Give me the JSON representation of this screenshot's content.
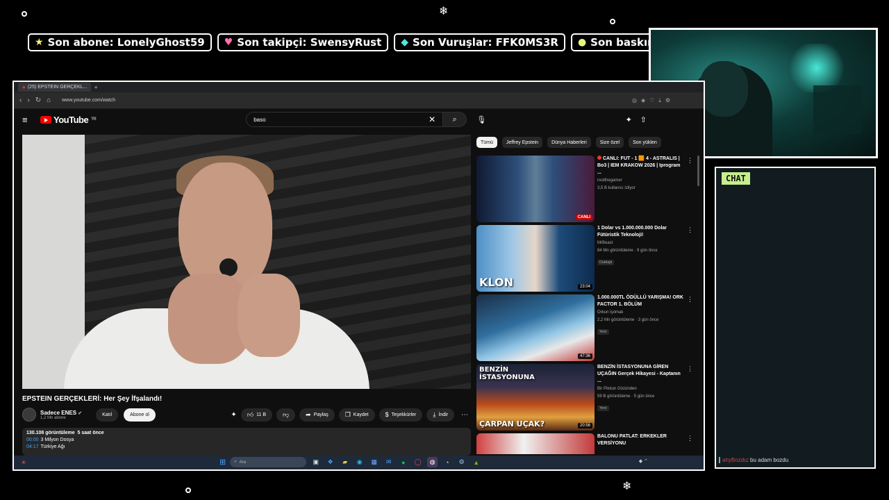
{
  "overlay": {
    "alerts": [
      {
        "icon": "star-icon",
        "glyph": "★",
        "text": "Son abone: LonelyGhost59",
        "color": "#fff27a"
      },
      {
        "icon": "heart-icon",
        "glyph": "♥",
        "text": "Son takipçi: SwensyRust",
        "color": "#ff6fae"
      },
      {
        "icon": "gem-icon",
        "glyph": "◆",
        "text": "Son Vuruşlar: FFK0MS3R",
        "color": "#4ee7e0"
      },
      {
        "icon": "coin-icon",
        "glyph": "●",
        "text": "Son baskın: tomrishim",
        "color": "#e9f57a"
      }
    ],
    "chat": {
      "tag": "CHAT",
      "message_user": "ahyBozdu",
      "message_text": ": bu adam bozdu"
    }
  },
  "browser": {
    "tab_title": "(25) EPSTEIN GERÇEKL...",
    "new_tab": "+",
    "url": "www.youtube.com/watch"
  },
  "youtube": {
    "logo": "YouTube",
    "country": "TR",
    "search_value": "baso",
    "video": {
      "title": "EPSTEIN GERÇEKLERİ: Her Şey İfşalandı!",
      "channel": "Sadece ENES",
      "subscribers": "1,2 Mn abone",
      "join_label": "Katıl",
      "subscribe_label": "Abone ol",
      "likes": "11 B",
      "share_label": "Paylaş",
      "save_label": "Kaydet",
      "thanks_label": "Teşekkürler",
      "download_label": "İndir",
      "views": "130.108 görüntüleme",
      "age": "5 saat önce",
      "chapters": [
        {
          "time": "00:00",
          "title": "3 Milyon Dosya"
        },
        {
          "time": "04:17",
          "title": "Türkiye Ağı"
        }
      ]
    },
    "chips": [
      "Tümü",
      "Jeffrey Epstein",
      "Dünya Haberleri",
      "Size özel",
      "Son yüklen"
    ],
    "recommendations": [
      {
        "title": "CANLI: FUT - 1 🟧 4 - ASTRALIS | Bo3 | IEM KRAKOW 2026 | Iprogram ...",
        "channel": "rootthegamer",
        "meta": "3,5 B kullanıcı izliyor",
        "badge": "",
        "duration": "",
        "live_label": "CANLI",
        "is_live": true,
        "overlay_text": "",
        "thumb_bg": "#1b2745"
      },
      {
        "title": "1 Dolar vs 1.000.000.000 Dolar Fütüristik Teknoloji!",
        "channel": "MrBeast",
        "meta": "84 Mn görüntüleme · 9 gün önce",
        "badge": "Dublajlı",
        "duration": "23:04",
        "live_label": "",
        "is_live": false,
        "overlay_text": "KLON",
        "thumb_bg": "#2e6fae"
      },
      {
        "title": "1.000.000TL ÖDÜLLÜ YARIŞMA! ORK FACTOR 1. BÖLÜM",
        "channel": "Orkun Işıtmak",
        "meta": "2,2 Mn görüntüleme · 3 gün önce",
        "badge": "Yeni",
        "duration": "47:36",
        "live_label": "",
        "is_live": false,
        "overlay_text": "",
        "thumb_bg": "#1f5f8f"
      },
      {
        "title": "BENZİN İSTASYONUNA GİREN UÇAĞIN Gerçek Hikayesi - Kaptanın ...",
        "channel": "Bir Pilotun Gözünden",
        "meta": "59 B görüntüleme · 5 gün önce",
        "badge": "Yeni",
        "duration": "20:56",
        "live_label": "",
        "is_live": false,
        "overlay_text": "BENZİN İSTASYONUNA",
        "overlay_text2": "ÇARPAN UÇAK?",
        "thumb_bg": "#9a4a1c"
      },
      {
        "title": "BALONU PATLAT: ERKEKLER VERSİYONU",
        "channel": "",
        "meta": "",
        "badge": "",
        "duration": "",
        "live_label": "",
        "is_live": false,
        "overlay_text": "",
        "thumb_bg": "#c23a3a"
      }
    ]
  },
  "taskbar": {
    "search_placeholder": "Ara"
  }
}
